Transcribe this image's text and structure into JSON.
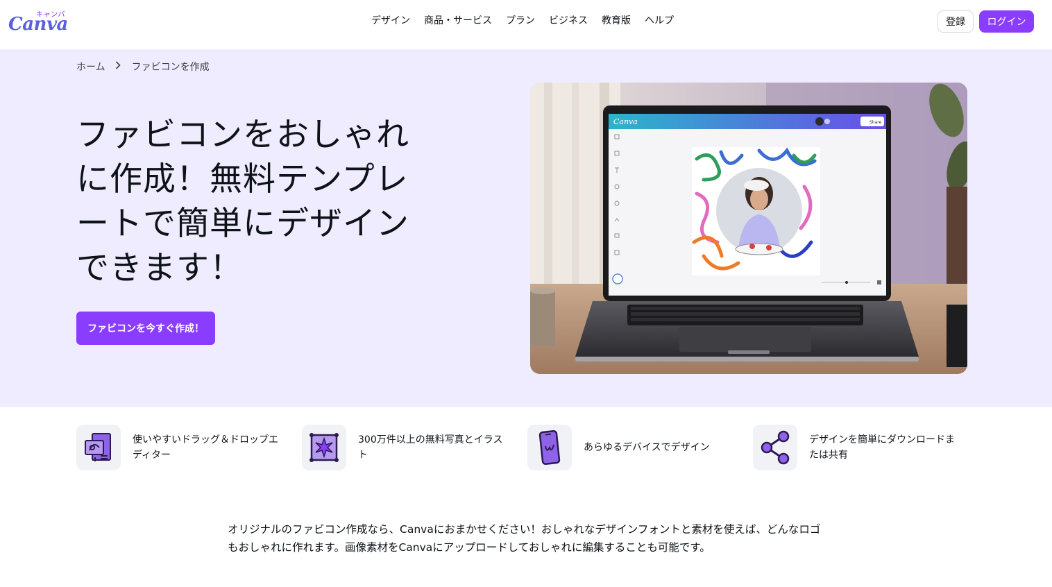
{
  "header": {
    "logo_kana": "キャンバ",
    "logo_word": "Canva",
    "nav": [
      "デザイン",
      "商品・サービス",
      "プラン",
      "ビジネス",
      "教育版",
      "ヘルプ"
    ],
    "register_label": "登録",
    "login_label": "ログイン"
  },
  "breadcrumb": {
    "home": "ホーム",
    "current": "ファビコンを作成"
  },
  "hero": {
    "title": "ファビコンをおしゃれに作成！無料テンプレートで簡単にデザインできます！",
    "cta_label": "ファビコンを今すぐ作成！",
    "image": {
      "app_logo": "Canva",
      "share_label": "Share"
    }
  },
  "features": [
    {
      "icon": "drag-drop-icon",
      "text": "使いやすいドラッグ＆ドロップエディター"
    },
    {
      "icon": "photo-illustration-icon",
      "text": "300万件以上の無料写真とイラスト"
    },
    {
      "icon": "mobile-device-icon",
      "text": "あらゆるデバイスでデザイン"
    },
    {
      "icon": "share-icon",
      "text": "デザインを簡単にダウンロードまたは共有"
    }
  ],
  "description": "オリジナルのファビコン作成なら、Canvaにおまかせください！おしゃれなデザインフォントと素材を使えば、どんなロゴもおしゃれに作れます。画像素材をCanvaにアップロードしておしゃれに編集することも可能です。",
  "colors": {
    "accent": "#8b3dff",
    "hero_bg": "#f0ecff",
    "icon_purple": "#6b3ecf"
  }
}
